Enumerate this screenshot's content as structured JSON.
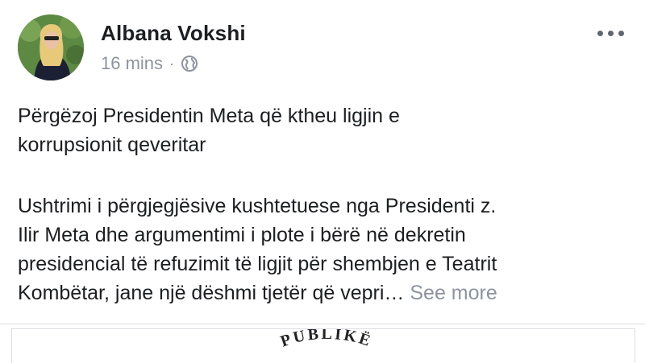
{
  "post": {
    "author": "Albana Vokshi",
    "time": "16 mins",
    "separator": "·",
    "privacy_icon": "globe-icon",
    "more_icon": "more-options-icon",
    "headline_lines": [
      "Përgëzoj Presidentin Meta që ktheu ligjin e",
      "korrupsionit qeveritar"
    ],
    "body_lines": [
      "Ushtrimi i përgjegjësive kushtetuese nga Presidenti z.",
      "Ilir Meta dhe argumentimi i plote i bërë në dekretin",
      "presidencial të refuzimit të ligjit për shembjen e Teatrit",
      "Kombëtar, jane një dëshmi tjetër që vepri…"
    ],
    "see_more": "See more"
  },
  "attachment": {
    "emblem_text": "PUBLIKË"
  }
}
